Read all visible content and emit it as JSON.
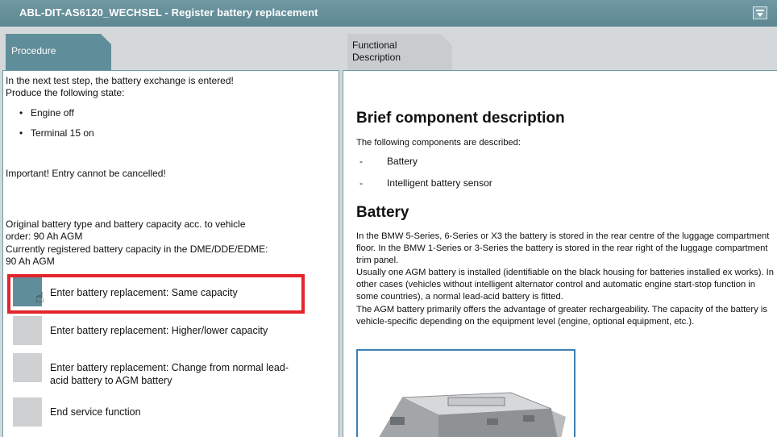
{
  "window": {
    "title": "ABL-DIT-AS6120_WECHSEL  -  Register battery replacement",
    "minimize_icon": "minimize-icon"
  },
  "tabs": {
    "procedure": "Procedure",
    "functional_description": "Functional Description"
  },
  "procedure": {
    "intro_1": "In the next test step, the battery exchange is entered!",
    "intro_2": "Produce the following state:",
    "states": [
      "Engine off",
      "Terminal 15 on"
    ],
    "important": "Important! Entry cannot be cancelled!",
    "original_1": "Original battery type and battery capacity acc. to vehicle",
    "original_2": "order: 90 Ah AGM",
    "current_1": "Currently registered battery capacity in the DME/DDE/EDME:",
    "current_2": "90 Ah AGM",
    "options": [
      "Enter battery replacement: Same capacity",
      "Enter battery replacement: Higher/lower capacity",
      "Enter battery replacement: Change from normal lead-acid battery to AGM battery",
      "End service function"
    ]
  },
  "description": {
    "heading": "Brief component description",
    "intro": "The following components are described:",
    "components": [
      "Battery",
      "Intelligent battery sensor"
    ],
    "battery_heading": "Battery",
    "para1": "In the BMW 5-Series, 6-Series or X3 the battery is stored in the rear centre of the luggage compartment floor. In the BMW 1-Series or 3-Series the battery is stored in the rear right of the luggage compartment trim panel.",
    "para2": "Usually one AGM battery is installed (identifiable on the black housing for batteries installed ex works). In other cases (vehicles without intelligent alternator control and automatic engine start-stop function in some countries), a normal lead-acid battery is fitted.",
    "para3": "The AGM battery primarily offers the advantage of greater rechargeability. The capacity of the battery is vehicle-specific depending on the equipment level (engine, optional equipment, etc.)."
  },
  "colors": {
    "titlebar": "#5c8791",
    "highlight": "#e3252c",
    "image_border": "#3d7fb4"
  }
}
